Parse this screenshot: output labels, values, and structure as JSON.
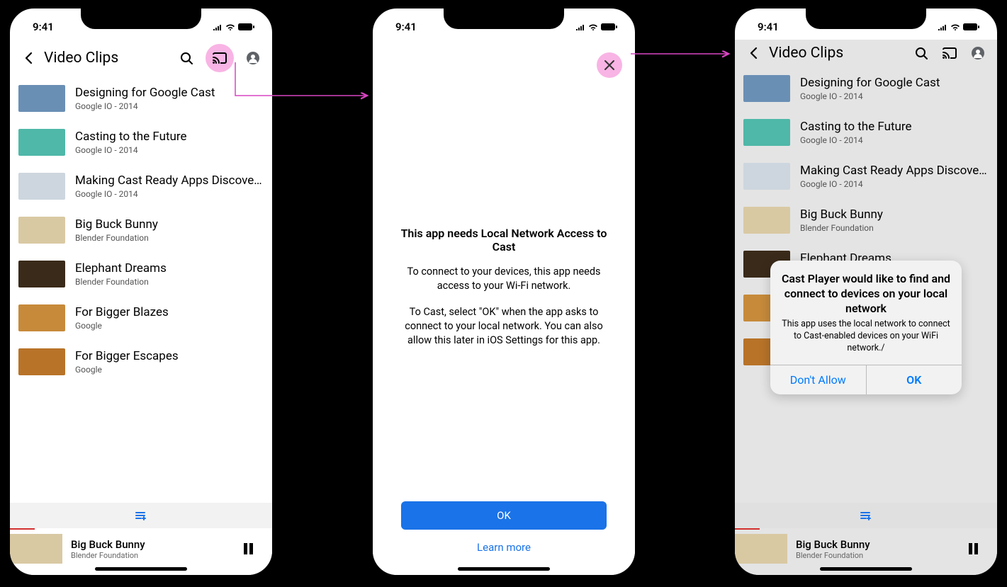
{
  "status": {
    "time": "9:41"
  },
  "screen1": {
    "nav_title": "Video Clips",
    "now_playing": {
      "title": "Big Buck Bunny",
      "subtitle": "Blender Foundation"
    }
  },
  "videos": [
    {
      "title": "Designing for Google Cast",
      "subtitle": "Google IO - 2014",
      "thumb": "#6a8fb5"
    },
    {
      "title": "Casting to the Future",
      "subtitle": "Google IO - 2014",
      "thumb": "#4fb8a8"
    },
    {
      "title": "Making Cast Ready Apps Discoverable via Google",
      "subtitle": "Google IO - 2014",
      "thumb": "#cdd6de"
    },
    {
      "title": "Big Buck Bunny",
      "subtitle": "Blender Foundation",
      "thumb": "#d9c9a3"
    },
    {
      "title": "Elephant Dreams",
      "subtitle": "Blender Foundation",
      "thumb": "#3a2a1a"
    },
    {
      "title": "For Bigger Blazes",
      "subtitle": "Google",
      "thumb": "#c78a3a"
    },
    {
      "title": "For Bigger Escapes",
      "subtitle": "Google",
      "thumb": "#b87328"
    }
  ],
  "explain": {
    "title": "This app needs Local Network Access to Cast",
    "p1": "To connect to your devices, this app needs access to your Wi-Fi network.",
    "p2": "To Cast, select \"OK\" when the app asks to connect to your local network. You can also allow this later in iOS Settings for this app.",
    "ok": "OK",
    "learn": "Learn more"
  },
  "alert": {
    "title": "Cast Player would like to find and connect to devices on your local network",
    "msg": "This app uses the local network to connect to Cast-enabled devices on your WiFi network./",
    "dont": "Don't Allow",
    "ok": "OK"
  }
}
